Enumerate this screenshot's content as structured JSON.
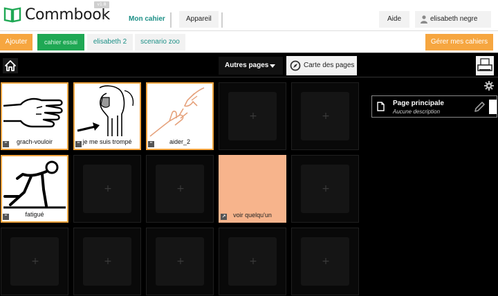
{
  "app": {
    "name": "Commbook",
    "version": "v1.8"
  },
  "nav": {
    "mon_cahier": "Mon cahier",
    "appareil": "Appareil",
    "aide": "Aide",
    "user": "elisabeth negre"
  },
  "notebooks": {
    "ajouter": "Ajouter",
    "items": [
      "cahier essai",
      "elisabeth 2",
      "scenario zoo"
    ],
    "gerer": "Gérer mes cahiers"
  },
  "toolbar": {
    "autres_pages": "Autres pages",
    "carte_des_pages": "Carte des pages"
  },
  "cards": [
    {
      "caption": "grach-vouloir",
      "picto": "hand-icon"
    },
    {
      "caption": "je me suis trompé",
      "picto": "elephant-arrow-icon"
    },
    {
      "caption": "aider_2",
      "picto": "helping-hands-icon"
    },
    {
      "caption": "fatigué",
      "picto": "tired-person-icon"
    },
    {
      "caption": "voir quelqu'un",
      "picto": "blank"
    }
  ],
  "panel": {
    "page_title": "Page principale",
    "page_desc": "Aucune description"
  },
  "colors": {
    "accent_orange": "#f6a640",
    "accent_green": "#1fa854",
    "accent_teal": "#1c8f86",
    "card_salmon": "#f7b48c"
  }
}
